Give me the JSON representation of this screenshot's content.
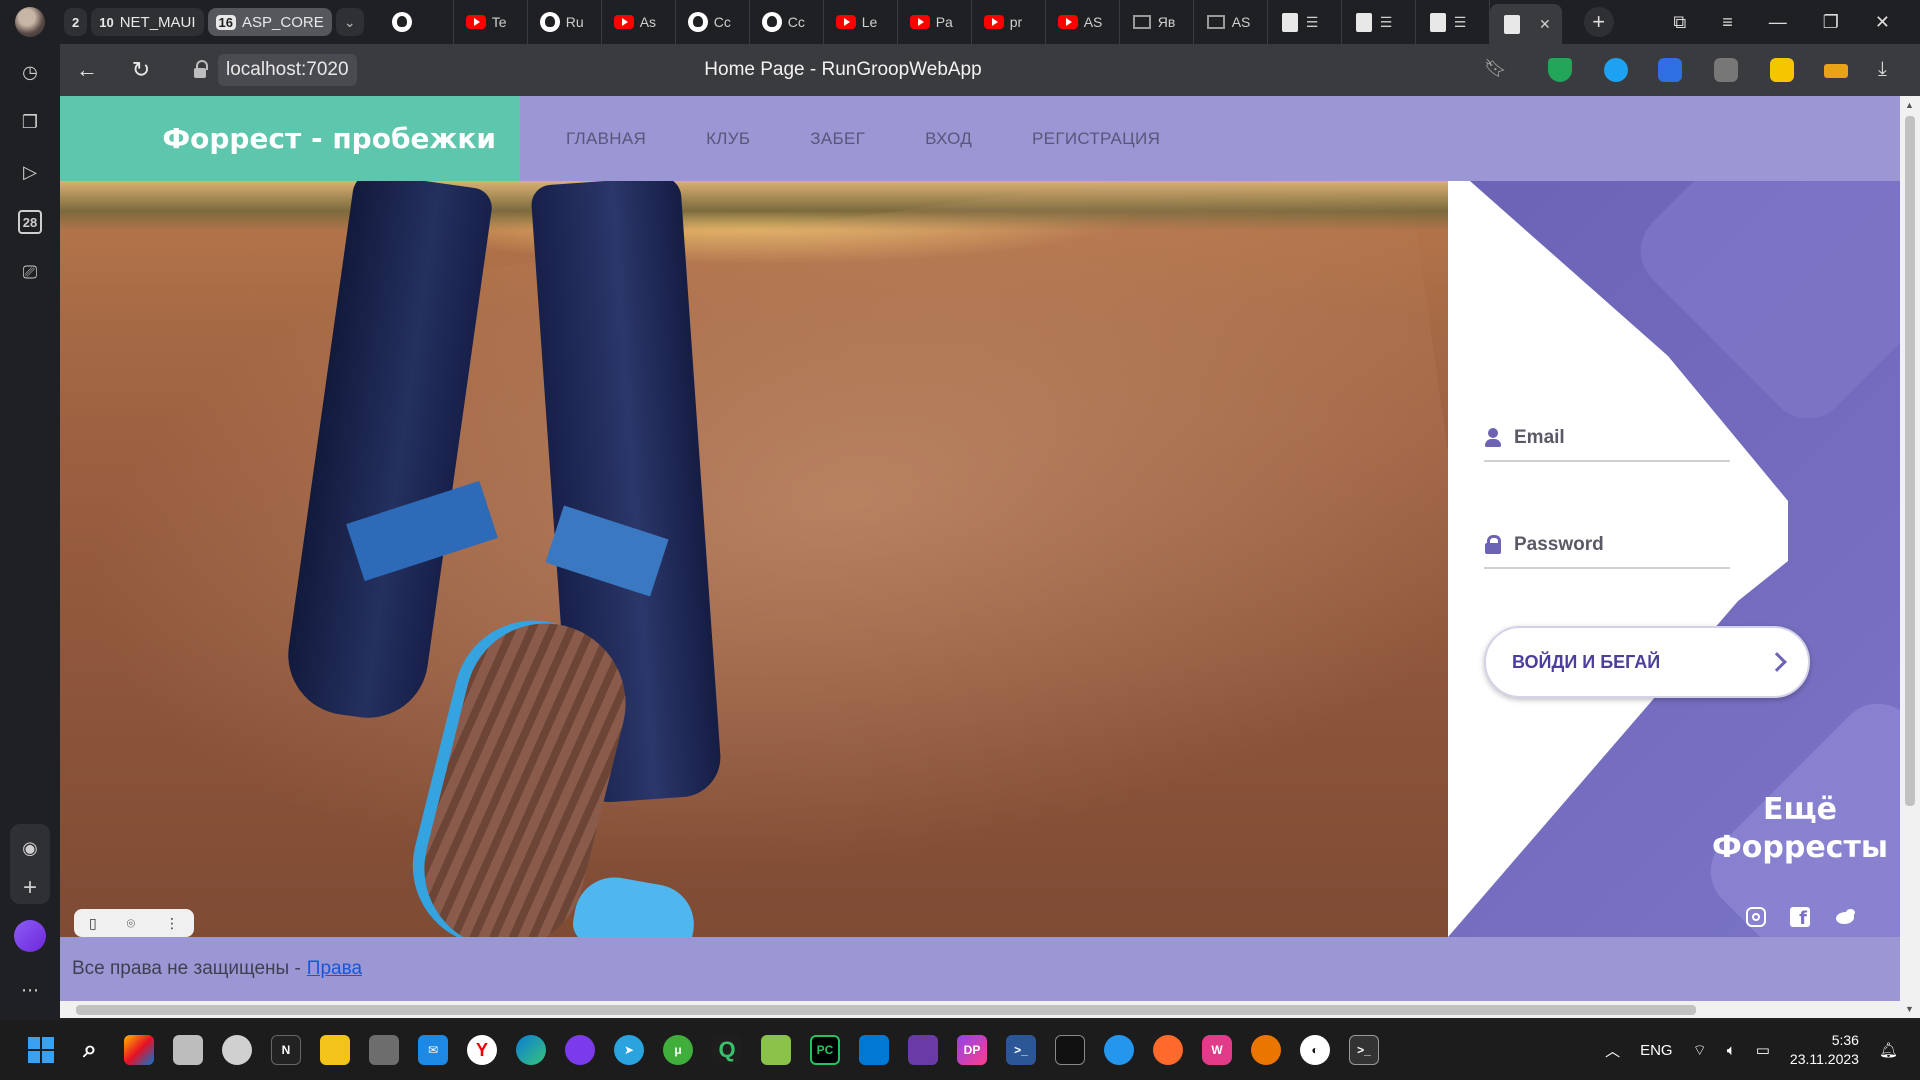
{
  "browser": {
    "tab_groups": [
      {
        "count": "2",
        "label": ""
      },
      {
        "count": "10",
        "label": "NET_MAUI"
      },
      {
        "count": "16",
        "label": "ASP_CORE"
      }
    ],
    "tabs": [
      {
        "icon": "github-icon",
        "text": ""
      },
      {
        "icon": "youtube-icon",
        "text": "Te"
      },
      {
        "icon": "github-icon",
        "text": "Ru"
      },
      {
        "icon": "youtube-icon",
        "text": "As"
      },
      {
        "icon": "github-icon",
        "text": "Cc"
      },
      {
        "icon": "github-icon",
        "text": "Cc"
      },
      {
        "icon": "youtube-icon",
        "text": "Le"
      },
      {
        "icon": "youtube-icon",
        "text": "Pa"
      },
      {
        "icon": "youtube-icon",
        "text": "pr"
      },
      {
        "icon": "youtube-icon",
        "text": "AS"
      },
      {
        "icon": "mail-icon",
        "text": "Яв"
      },
      {
        "icon": "mail-icon",
        "text": "AS"
      },
      {
        "icon": "document-icon",
        "text": "☰"
      },
      {
        "icon": "document-icon",
        "text": "☰"
      },
      {
        "icon": "document-icon",
        "text": "☰"
      }
    ],
    "current_tab_close": "✕",
    "url": "localhost:7020",
    "page_title": "Home Page - RunGroopWebApp",
    "sidebar_calendar": "28"
  },
  "site": {
    "brand": "Форрест - пробежки",
    "nav": [
      "ГЛАВНАЯ",
      "КЛУБ",
      "ЗАБЕГ",
      "ВХОД",
      "РЕГИСТРАЦИЯ"
    ],
    "login": {
      "email_placeholder": "Email",
      "password_placeholder": "Password",
      "button_label": "ВОЙДИ И БЕГАЙ"
    },
    "more_title": "Ещё Форресты",
    "social": [
      "instagram-icon",
      "facebook-icon",
      "twitter-icon"
    ],
    "footer": {
      "text": "Все права не защищены - ",
      "link": "Права"
    }
  },
  "taskbar": {
    "language": "ENG",
    "time": "5:36",
    "date": "23.11.2023"
  },
  "colors": {
    "header_purple": "#9b97d4",
    "brand_green": "#5dc6ac",
    "login_purple": "#6b63b5"
  }
}
